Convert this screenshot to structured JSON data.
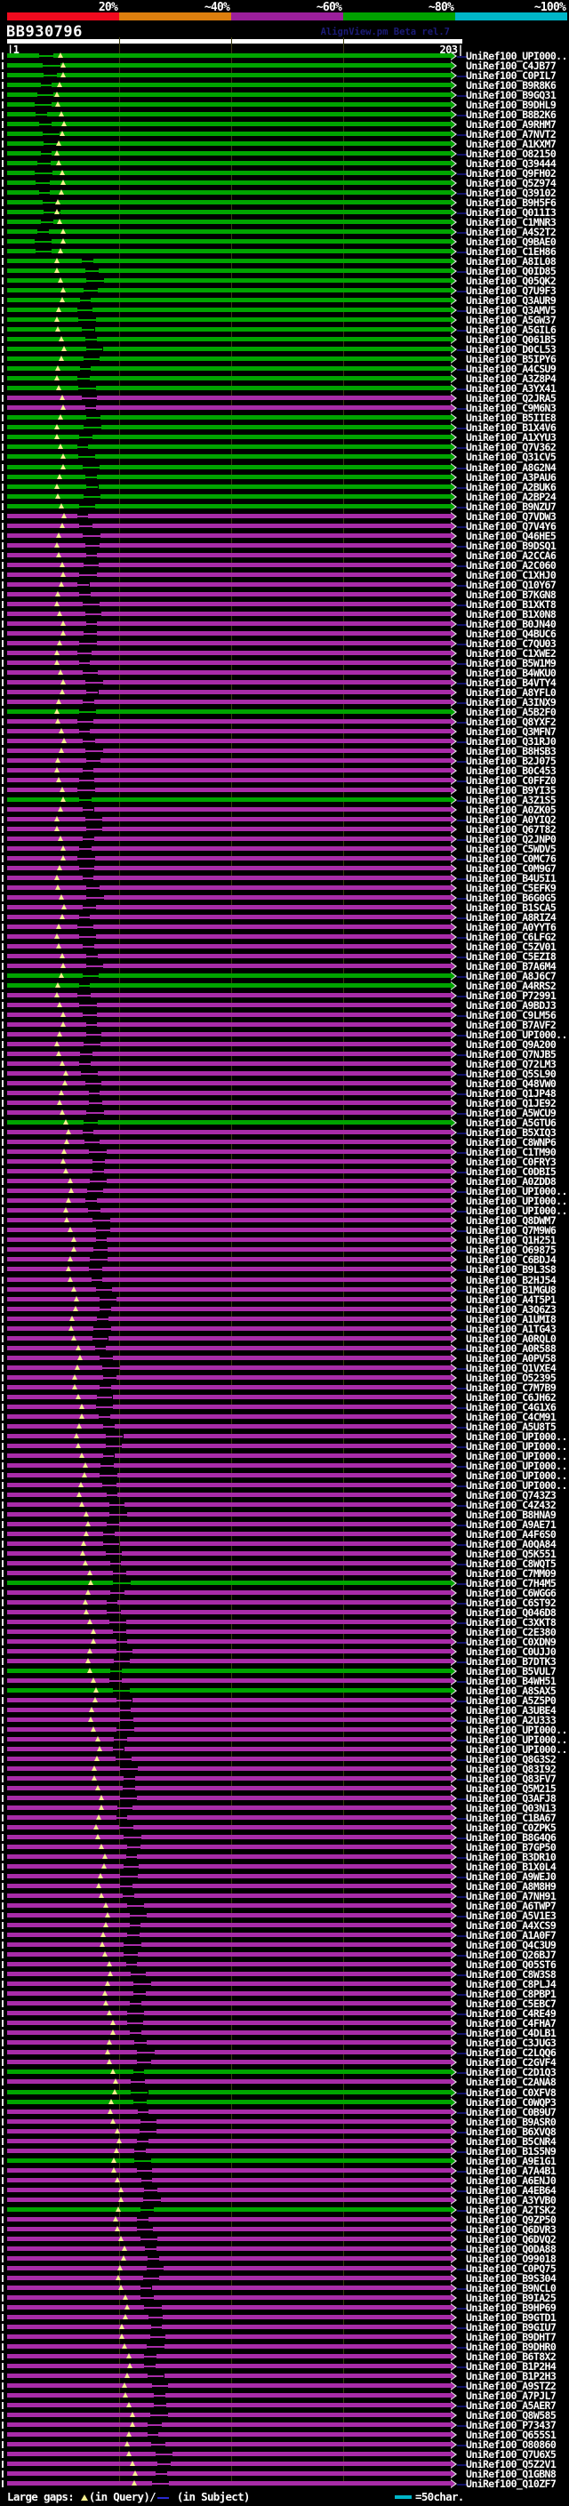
{
  "header": {
    "query_id": "BB930796",
    "app_title": "AlignView.pm Beta rel.7",
    "ruler_left_label": "|1",
    "ruler_right_label": "203|"
  },
  "footer": {
    "prefix": "Large gaps: ",
    "query_gap_symbol": "▲",
    "query_gap_text": "(in Query)/",
    "subject_gap_symbol": "-",
    "subject_gap_text": " (in Subject)",
    "unit_text": "=50char."
  },
  "colors": {
    "green_bar": "#00a400",
    "magenta_bar": "#a82ca8",
    "connector": "#12126a",
    "gridline": "#3a3a10",
    "triangle": "#f5ef8e",
    "subject_dash": "#2a2ad2",
    "unit_dash": "#00b6c8"
  },
  "chart_data": {
    "type": "bar",
    "title": "BB930796",
    "x_axis": {
      "start": 1,
      "end": 203,
      "tick_interval_chars": 50,
      "gridlines_at_chars": [
        51,
        101,
        151
      ]
    },
    "identity_scale": [
      {
        "label": "20%",
        "color": "#f00a1e"
      },
      {
        "label": "~40%",
        "color": "#dd7f0e"
      },
      {
        "label": "~60%",
        "color": "#9b1f9b"
      },
      {
        "label": "~80%",
        "color": "#00a000"
      },
      {
        "label": "~100%",
        "color": "#00b6c8"
      }
    ],
    "hits": [
      {
        "label": "UniRef100_UPI000..",
        "tier": "g"
      },
      {
        "label": "UniRef100_C4JB77",
        "tier": "g"
      },
      {
        "label": "UniRef100_C0PIL7",
        "tier": "g"
      },
      {
        "label": "UniRef100_B9R8K6",
        "tier": "g"
      },
      {
        "label": "UniRef100_B9GQ31",
        "tier": "g"
      },
      {
        "label": "UniRef100_B9DHL9",
        "tier": "g"
      },
      {
        "label": "UniRef100_B8B2K6",
        "tier": "g"
      },
      {
        "label": "UniRef100_A9RHM7",
        "tier": "g"
      },
      {
        "label": "UniRef100_A7NVT2",
        "tier": "g"
      },
      {
        "label": "UniRef100_A1KXM7",
        "tier": "g"
      },
      {
        "label": "UniRef100_O82150",
        "tier": "g"
      },
      {
        "label": "UniRef100_Q39444",
        "tier": "g"
      },
      {
        "label": "UniRef100_Q9FH02",
        "tier": "g"
      },
      {
        "label": "UniRef100_Q5Z974",
        "tier": "g"
      },
      {
        "label": "UniRef100_Q39102",
        "tier": "g"
      },
      {
        "label": "UniRef100_B9H5F6",
        "tier": "g"
      },
      {
        "label": "UniRef100_Q011I3",
        "tier": "g"
      },
      {
        "label": "UniRef100_C1MNR3",
        "tier": "g"
      },
      {
        "label": "UniRef100_A4S2T2",
        "tier": "g"
      },
      {
        "label": "UniRef100_Q9BAE0",
        "tier": "g"
      },
      {
        "label": "UniRef100_C1EH86",
        "tier": "g"
      },
      {
        "label": "UniRef100_A8IL08",
        "tier": "g"
      },
      {
        "label": "UniRef100_Q0ID85",
        "tier": "g"
      },
      {
        "label": "UniRef100_Q05QK2",
        "tier": "g"
      },
      {
        "label": "UniRef100_Q7U9F3",
        "tier": "g"
      },
      {
        "label": "UniRef100_Q3AUR9",
        "tier": "g"
      },
      {
        "label": "UniRef100_Q3AMV5",
        "tier": "g"
      },
      {
        "label": "UniRef100_A5GW37",
        "tier": "g"
      },
      {
        "label": "UniRef100_A5GIL6",
        "tier": "g"
      },
      {
        "label": "UniRef100_Q061B5",
        "tier": "g"
      },
      {
        "label": "UniRef100_D0CL53",
        "tier": "g"
      },
      {
        "label": "UniRef100_B5IPY6",
        "tier": "g"
      },
      {
        "label": "UniRef100_A4CSU9",
        "tier": "g"
      },
      {
        "label": "UniRef100_A3Z8P4",
        "tier": "g"
      },
      {
        "label": "UniRef100_A3YX41",
        "tier": "g"
      },
      {
        "label": "UniRef100_Q2JRA5",
        "tier": "m"
      },
      {
        "label": "UniRef100_C9M6N3",
        "tier": "m"
      },
      {
        "label": "UniRef100_B5IIE8",
        "tier": "g"
      },
      {
        "label": "UniRef100_B1X4V6",
        "tier": "g"
      },
      {
        "label": "UniRef100_A1XYU3",
        "tier": "g"
      },
      {
        "label": "UniRef100_Q7V362",
        "tier": "g"
      },
      {
        "label": "UniRef100_Q31CV5",
        "tier": "g"
      },
      {
        "label": "UniRef100_A8G2N4",
        "tier": "g"
      },
      {
        "label": "UniRef100_A3PAU6",
        "tier": "g"
      },
      {
        "label": "UniRef100_A2BUK6",
        "tier": "g"
      },
      {
        "label": "UniRef100_A2BP24",
        "tier": "g"
      },
      {
        "label": "UniRef100_B9NZU7",
        "tier": "g"
      },
      {
        "label": "UniRef100_Q7VDW3",
        "tier": "m"
      },
      {
        "label": "UniRef100_Q7V4Y6",
        "tier": "m"
      },
      {
        "label": "UniRef100_Q46HE5",
        "tier": "m"
      },
      {
        "label": "UniRef100_B9DSQ1",
        "tier": "m"
      },
      {
        "label": "UniRef100_A2CCA6",
        "tier": "m"
      },
      {
        "label": "UniRef100_A2C060",
        "tier": "m"
      },
      {
        "label": "UniRef100_C1XHJ0",
        "tier": "m"
      },
      {
        "label": "UniRef100_Q10Y67",
        "tier": "m"
      },
      {
        "label": "UniRef100_B7KGN8",
        "tier": "m"
      },
      {
        "label": "UniRef100_B1XKT8",
        "tier": "m"
      },
      {
        "label": "UniRef100_B1X0N8",
        "tier": "m"
      },
      {
        "label": "UniRef100_B0JN40",
        "tier": "m"
      },
      {
        "label": "UniRef100_Q4BUC6",
        "tier": "m"
      },
      {
        "label": "UniRef100_C7QU03",
        "tier": "m"
      },
      {
        "label": "UniRef100_C1XWE2",
        "tier": "m"
      },
      {
        "label": "UniRef100_B5W1M9",
        "tier": "m"
      },
      {
        "label": "UniRef100_B4WKU0",
        "tier": "m"
      },
      {
        "label": "UniRef100_B4VTY4",
        "tier": "m"
      },
      {
        "label": "UniRef100_A8YFL0",
        "tier": "m"
      },
      {
        "label": "UniRef100_A3INX9",
        "tier": "m"
      },
      {
        "label": "UniRef100_A5B2F0",
        "tier": "g"
      },
      {
        "label": "UniRef100_Q8YXF2",
        "tier": "m"
      },
      {
        "label": "UniRef100_Q3MFN7",
        "tier": "m"
      },
      {
        "label": "UniRef100_Q31RJ0",
        "tier": "m"
      },
      {
        "label": "UniRef100_B8HSB3",
        "tier": "m"
      },
      {
        "label": "UniRef100_B2J075",
        "tier": "m"
      },
      {
        "label": "UniRef100_B0C453",
        "tier": "m"
      },
      {
        "label": "UniRef100_C0FFZ0",
        "tier": "m"
      },
      {
        "label": "UniRef100_B9YI35",
        "tier": "m"
      },
      {
        "label": "UniRef100_A3Z1S5",
        "tier": "g"
      },
      {
        "label": "UniRef100_A0ZK05",
        "tier": "m"
      },
      {
        "label": "UniRef100_A0YIQ2",
        "tier": "m"
      },
      {
        "label": "UniRef100_Q67T82",
        "tier": "m"
      },
      {
        "label": "UniRef100_Q2JNP0",
        "tier": "m"
      },
      {
        "label": "UniRef100_C5WDV5",
        "tier": "m"
      },
      {
        "label": "UniRef100_C0MC76",
        "tier": "m"
      },
      {
        "label": "UniRef100_C0M9G7",
        "tier": "m"
      },
      {
        "label": "UniRef100_B4U5I1",
        "tier": "m"
      },
      {
        "label": "UniRef100_C5EFK9",
        "tier": "m"
      },
      {
        "label": "UniRef100_B6G0G5",
        "tier": "m"
      },
      {
        "label": "UniRef100_B1SCA5",
        "tier": "m"
      },
      {
        "label": "UniRef100_A8RIZ4",
        "tier": "m"
      },
      {
        "label": "UniRef100_A0YYT6",
        "tier": "m"
      },
      {
        "label": "UniRef100_C6LFG2",
        "tier": "m"
      },
      {
        "label": "UniRef100_C5ZV01",
        "tier": "m"
      },
      {
        "label": "UniRef100_C5EZI8",
        "tier": "m"
      },
      {
        "label": "UniRef100_B7A6M4",
        "tier": "m"
      },
      {
        "label": "UniRef100_A8J6C7",
        "tier": "g"
      },
      {
        "label": "UniRef100_A4RRS2",
        "tier": "g"
      },
      {
        "label": "UniRef100_P72991",
        "tier": "m"
      },
      {
        "label": "UniRef100_A9BDJ3",
        "tier": "m"
      },
      {
        "label": "UniRef100_C9LM56",
        "tier": "m"
      },
      {
        "label": "UniRef100_B7AVF2",
        "tier": "m"
      },
      {
        "label": "UniRef100_UPI000..",
        "tier": "m"
      },
      {
        "label": "UniRef100_Q9A200",
        "tier": "m"
      },
      {
        "label": "UniRef100_Q7NJB5",
        "tier": "m"
      },
      {
        "label": "UniRef100_Q72LM3",
        "tier": "m"
      },
      {
        "label": "UniRef100_Q5SL90",
        "tier": "m"
      },
      {
        "label": "UniRef100_Q48VW0",
        "tier": "m"
      },
      {
        "label": "UniRef100_Q1JP48",
        "tier": "m"
      },
      {
        "label": "UniRef100_Q1JE92",
        "tier": "m"
      },
      {
        "label": "UniRef100_A5WCU9",
        "tier": "m"
      },
      {
        "label": "UniRef100_A5GTU6",
        "tier": "g"
      },
      {
        "label": "UniRef100_B5XIQ3",
        "tier": "m"
      },
      {
        "label": "UniRef100_C8WNP6",
        "tier": "m"
      },
      {
        "label": "UniRef100_C1TM90",
        "tier": "m"
      },
      {
        "label": "UniRef100_C0FRY3",
        "tier": "m"
      },
      {
        "label": "UniRef100_C0DBI5",
        "tier": "m"
      },
      {
        "label": "UniRef100_A0ZDD8",
        "tier": "m"
      },
      {
        "label": "UniRef100_UPI000..",
        "tier": "m"
      },
      {
        "label": "UniRef100_UPI000..",
        "tier": "m"
      },
      {
        "label": "UniRef100_UPI000..",
        "tier": "m"
      },
      {
        "label": "UniRef100_Q8DWM7",
        "tier": "m"
      },
      {
        "label": "UniRef100_Q7M9W6",
        "tier": "m"
      },
      {
        "label": "UniRef100_Q1H251",
        "tier": "m"
      },
      {
        "label": "UniRef100_O69875",
        "tier": "m"
      },
      {
        "label": "UniRef100_C6BDJ4",
        "tier": "m"
      },
      {
        "label": "UniRef100_B9L3S8",
        "tier": "m"
      },
      {
        "label": "UniRef100_B2HJ54",
        "tier": "m"
      },
      {
        "label": "UniRef100_B1MGU8",
        "tier": "m"
      },
      {
        "label": "UniRef100_A4T5P1",
        "tier": "m"
      },
      {
        "label": "UniRef100_A3Q6Z3",
        "tier": "m"
      },
      {
        "label": "UniRef100_A1UMI8",
        "tier": "m"
      },
      {
        "label": "UniRef100_A1TG43",
        "tier": "m"
      },
      {
        "label": "UniRef100_A0RQL0",
        "tier": "m"
      },
      {
        "label": "UniRef100_A0R588",
        "tier": "m"
      },
      {
        "label": "UniRef100_A0PV58",
        "tier": "m"
      },
      {
        "label": "UniRef100_Q1VXE4",
        "tier": "m"
      },
      {
        "label": "UniRef100_O52395",
        "tier": "m"
      },
      {
        "label": "UniRef100_C7M7B9",
        "tier": "m"
      },
      {
        "label": "UniRef100_C6JH62",
        "tier": "m"
      },
      {
        "label": "UniRef100_C4G1X6",
        "tier": "m"
      },
      {
        "label": "UniRef100_C4CM91",
        "tier": "m"
      },
      {
        "label": "UniRef100_A5U8T5",
        "tier": "m"
      },
      {
        "label": "UniRef100_UPI000..",
        "tier": "m"
      },
      {
        "label": "UniRef100_UPI000..",
        "tier": "m"
      },
      {
        "label": "UniRef100_UPI000..",
        "tier": "m"
      },
      {
        "label": "UniRef100_UPI000..",
        "tier": "m"
      },
      {
        "label": "UniRef100_UPI000..",
        "tier": "m"
      },
      {
        "label": "UniRef100_UPI000..",
        "tier": "m"
      },
      {
        "label": "UniRef100_Q743Z3",
        "tier": "m"
      },
      {
        "label": "UniRef100_C4Z432",
        "tier": "m"
      },
      {
        "label": "UniRef100_B8HNA9",
        "tier": "m"
      },
      {
        "label": "UniRef100_A9AE71",
        "tier": "m"
      },
      {
        "label": "UniRef100_A4F6S0",
        "tier": "m"
      },
      {
        "label": "UniRef100_A0QA84",
        "tier": "m"
      },
      {
        "label": "UniRef100_Q5K551",
        "tier": "m"
      },
      {
        "label": "UniRef100_C8WQT5",
        "tier": "m"
      },
      {
        "label": "UniRef100_C7MM09",
        "tier": "m"
      },
      {
        "label": "UniRef100_C7H4M5",
        "tier": "g"
      },
      {
        "label": "UniRef100_C6WGG6",
        "tier": "m"
      },
      {
        "label": "UniRef100_C6ST92",
        "tier": "m"
      },
      {
        "label": "UniRef100_Q046D8",
        "tier": "m"
      },
      {
        "label": "UniRef100_C3XKT8",
        "tier": "m"
      },
      {
        "label": "UniRef100_C2E380",
        "tier": "m"
      },
      {
        "label": "UniRef100_C0XDN9",
        "tier": "m"
      },
      {
        "label": "UniRef100_C0UJJ0",
        "tier": "m"
      },
      {
        "label": "UniRef100_B7DTK3",
        "tier": "m"
      },
      {
        "label": "UniRef100_B5VUL7",
        "tier": "g"
      },
      {
        "label": "UniRef100_B4WH51",
        "tier": "m"
      },
      {
        "label": "UniRef100_A8SAX5",
        "tier": "g"
      },
      {
        "label": "UniRef100_A5Z5P0",
        "tier": "m"
      },
      {
        "label": "UniRef100_A3UBE4",
        "tier": "m"
      },
      {
        "label": "UniRef100_A2U333",
        "tier": "m"
      },
      {
        "label": "UniRef100_UPI000..",
        "tier": "m"
      },
      {
        "label": "UniRef100_UPI000..",
        "tier": "m"
      },
      {
        "label": "UniRef100_UPI000..",
        "tier": "m"
      },
      {
        "label": "UniRef100_Q8G3S2",
        "tier": "m"
      },
      {
        "label": "UniRef100_Q83I92",
        "tier": "m"
      },
      {
        "label": "UniRef100_Q83FV7",
        "tier": "m"
      },
      {
        "label": "UniRef100_Q5M215",
        "tier": "m"
      },
      {
        "label": "UniRef100_Q3AFJ8",
        "tier": "m"
      },
      {
        "label": "UniRef100_Q03N13",
        "tier": "m"
      },
      {
        "label": "UniRef100_C1BA67",
        "tier": "m"
      },
      {
        "label": "UniRef100_C0ZPK5",
        "tier": "m"
      },
      {
        "label": "UniRef100_B8G4Q6",
        "tier": "m"
      },
      {
        "label": "UniRef100_B7GP50",
        "tier": "m"
      },
      {
        "label": "UniRef100_B3DR10",
        "tier": "m"
      },
      {
        "label": "UniRef100_B1X0L4",
        "tier": "m"
      },
      {
        "label": "UniRef100_A9WEJ0",
        "tier": "m"
      },
      {
        "label": "UniRef100_A8M8H9",
        "tier": "m"
      },
      {
        "label": "UniRef100_A7NH91",
        "tier": "m"
      },
      {
        "label": "UniRef100_A6TWP7",
        "tier": "m"
      },
      {
        "label": "UniRef100_A5V1E3",
        "tier": "m"
      },
      {
        "label": "UniRef100_A4XCS9",
        "tier": "m"
      },
      {
        "label": "UniRef100_A1A0F7",
        "tier": "m"
      },
      {
        "label": "UniRef100_Q4C3U9",
        "tier": "m"
      },
      {
        "label": "UniRef100_Q26BJ7",
        "tier": "m"
      },
      {
        "label": "UniRef100_Q05ST6",
        "tier": "m"
      },
      {
        "label": "UniRef100_C8W3S8",
        "tier": "m"
      },
      {
        "label": "UniRef100_C8PLJ4",
        "tier": "m"
      },
      {
        "label": "UniRef100_C8PBP1",
        "tier": "m"
      },
      {
        "label": "UniRef100_C5EBC7",
        "tier": "m"
      },
      {
        "label": "UniRef100_C4RE49",
        "tier": "m"
      },
      {
        "label": "UniRef100_C4FHA7",
        "tier": "m"
      },
      {
        "label": "UniRef100_C4DLB1",
        "tier": "m"
      },
      {
        "label": "UniRef100_C3JUG3",
        "tier": "m"
      },
      {
        "label": "UniRef100_C2LQQ6",
        "tier": "m"
      },
      {
        "label": "UniRef100_C2GVF4",
        "tier": "m"
      },
      {
        "label": "UniRef100_C2D1Q3",
        "tier": "g"
      },
      {
        "label": "UniRef100_C2ANA8",
        "tier": "m"
      },
      {
        "label": "UniRef100_C0XFV8",
        "tier": "g"
      },
      {
        "label": "UniRef100_C0WQP3",
        "tier": "g"
      },
      {
        "label": "UniRef100_C0B9U7",
        "tier": "m"
      },
      {
        "label": "UniRef100_B9ASR0",
        "tier": "m"
      },
      {
        "label": "UniRef100_B6XVQ8",
        "tier": "m"
      },
      {
        "label": "UniRef100_B5CNR4",
        "tier": "m"
      },
      {
        "label": "UniRef100_B1S5N9",
        "tier": "m"
      },
      {
        "label": "UniRef100_A9E1G1",
        "tier": "g"
      },
      {
        "label": "UniRef100_A7A4B1",
        "tier": "m"
      },
      {
        "label": "UniRef100_A6ENJ0",
        "tier": "m"
      },
      {
        "label": "UniRef100_A4EB64",
        "tier": "m"
      },
      {
        "label": "UniRef100_A3YVB0",
        "tier": "m"
      },
      {
        "label": "UniRef100_A2TSK2",
        "tier": "g"
      },
      {
        "label": "UniRef100_Q9ZP50",
        "tier": "m"
      },
      {
        "label": "UniRef100_Q6DVR3",
        "tier": "m"
      },
      {
        "label": "UniRef100_Q6DVQ2",
        "tier": "m"
      },
      {
        "label": "UniRef100_Q0DA88",
        "tier": "m"
      },
      {
        "label": "UniRef100_O99018",
        "tier": "m"
      },
      {
        "label": "UniRef100_C0PQ75",
        "tier": "m"
      },
      {
        "label": "UniRef100_B9S304",
        "tier": "m"
      },
      {
        "label": "UniRef100_B9NCL0",
        "tier": "m"
      },
      {
        "label": "UniRef100_B9IA25",
        "tier": "m"
      },
      {
        "label": "UniRef100_B9HP69",
        "tier": "m"
      },
      {
        "label": "UniRef100_B9GTD1",
        "tier": "m"
      },
      {
        "label": "UniRef100_B9GIU7",
        "tier": "m"
      },
      {
        "label": "UniRef100_B9DHT7",
        "tier": "m"
      },
      {
        "label": "UniRef100_B9DHR0",
        "tier": "m"
      },
      {
        "label": "UniRef100_B6T8X2",
        "tier": "m"
      },
      {
        "label": "UniRef100_B1P2H4",
        "tier": "m"
      },
      {
        "label": "UniRef100_B1P2H3",
        "tier": "m"
      },
      {
        "label": "UniRef100_A9STZ2",
        "tier": "m"
      },
      {
        "label": "UniRef100_A7PJL7",
        "tier": "m"
      },
      {
        "label": "UniRef100_A5AER7",
        "tier": "m"
      },
      {
        "label": "UniRef100_Q8W585",
        "tier": "m"
      },
      {
        "label": "UniRef100_P73437",
        "tier": "m"
      },
      {
        "label": "UniRef100_Q655S1",
        "tier": "m"
      },
      {
        "label": "UniRef100_O80860",
        "tier": "m"
      },
      {
        "label": "UniRef100_Q7U6X5",
        "tier": "m"
      },
      {
        "label": "UniRef100_Q5Z2V1",
        "tier": "m"
      },
      {
        "label": "UniRef100_Q1GBN8",
        "tier": "m"
      },
      {
        "label": "UniRef100_Q10ZF7",
        "tier": "m"
      }
    ]
  }
}
